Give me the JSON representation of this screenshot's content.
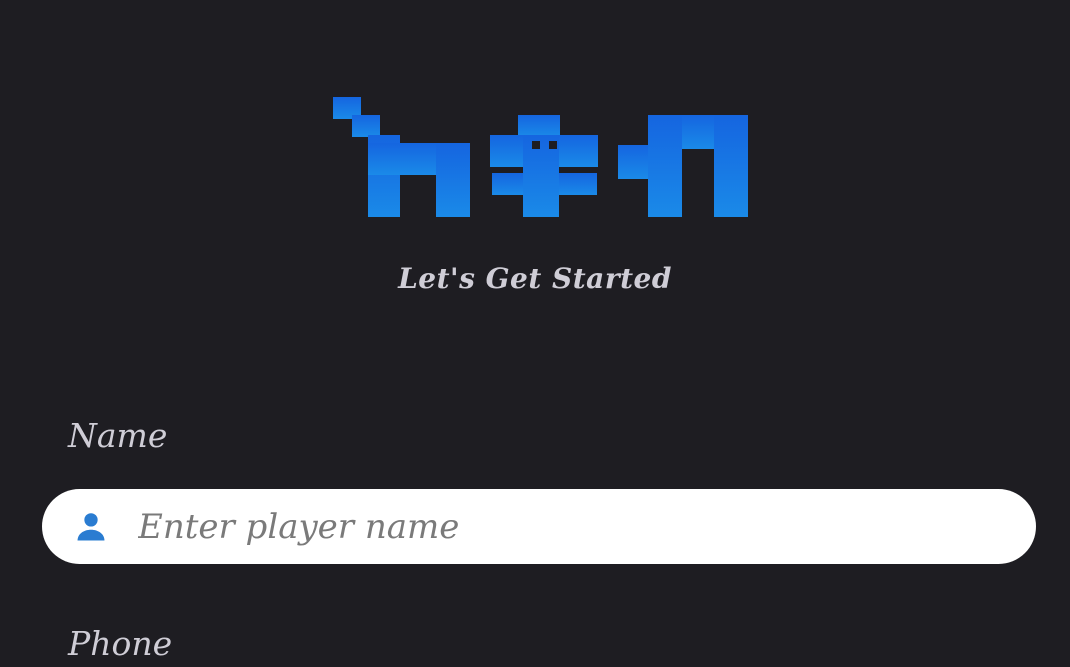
{
  "logo": {
    "alt": "ትዕዛዝ logo",
    "color_top": "#1565e0",
    "color_bottom": "#1a8ae8"
  },
  "tagline": "Let's Get Started",
  "form": {
    "name_label": "Name",
    "name_placeholder": "Enter player name",
    "name_value": "",
    "name_icon": "person-icon",
    "phone_label": "Phone"
  },
  "colors": {
    "background": "#1e1d22",
    "text": "#cfcdd6",
    "input_background": "#ffffff",
    "icon": "#2a7cd1"
  }
}
